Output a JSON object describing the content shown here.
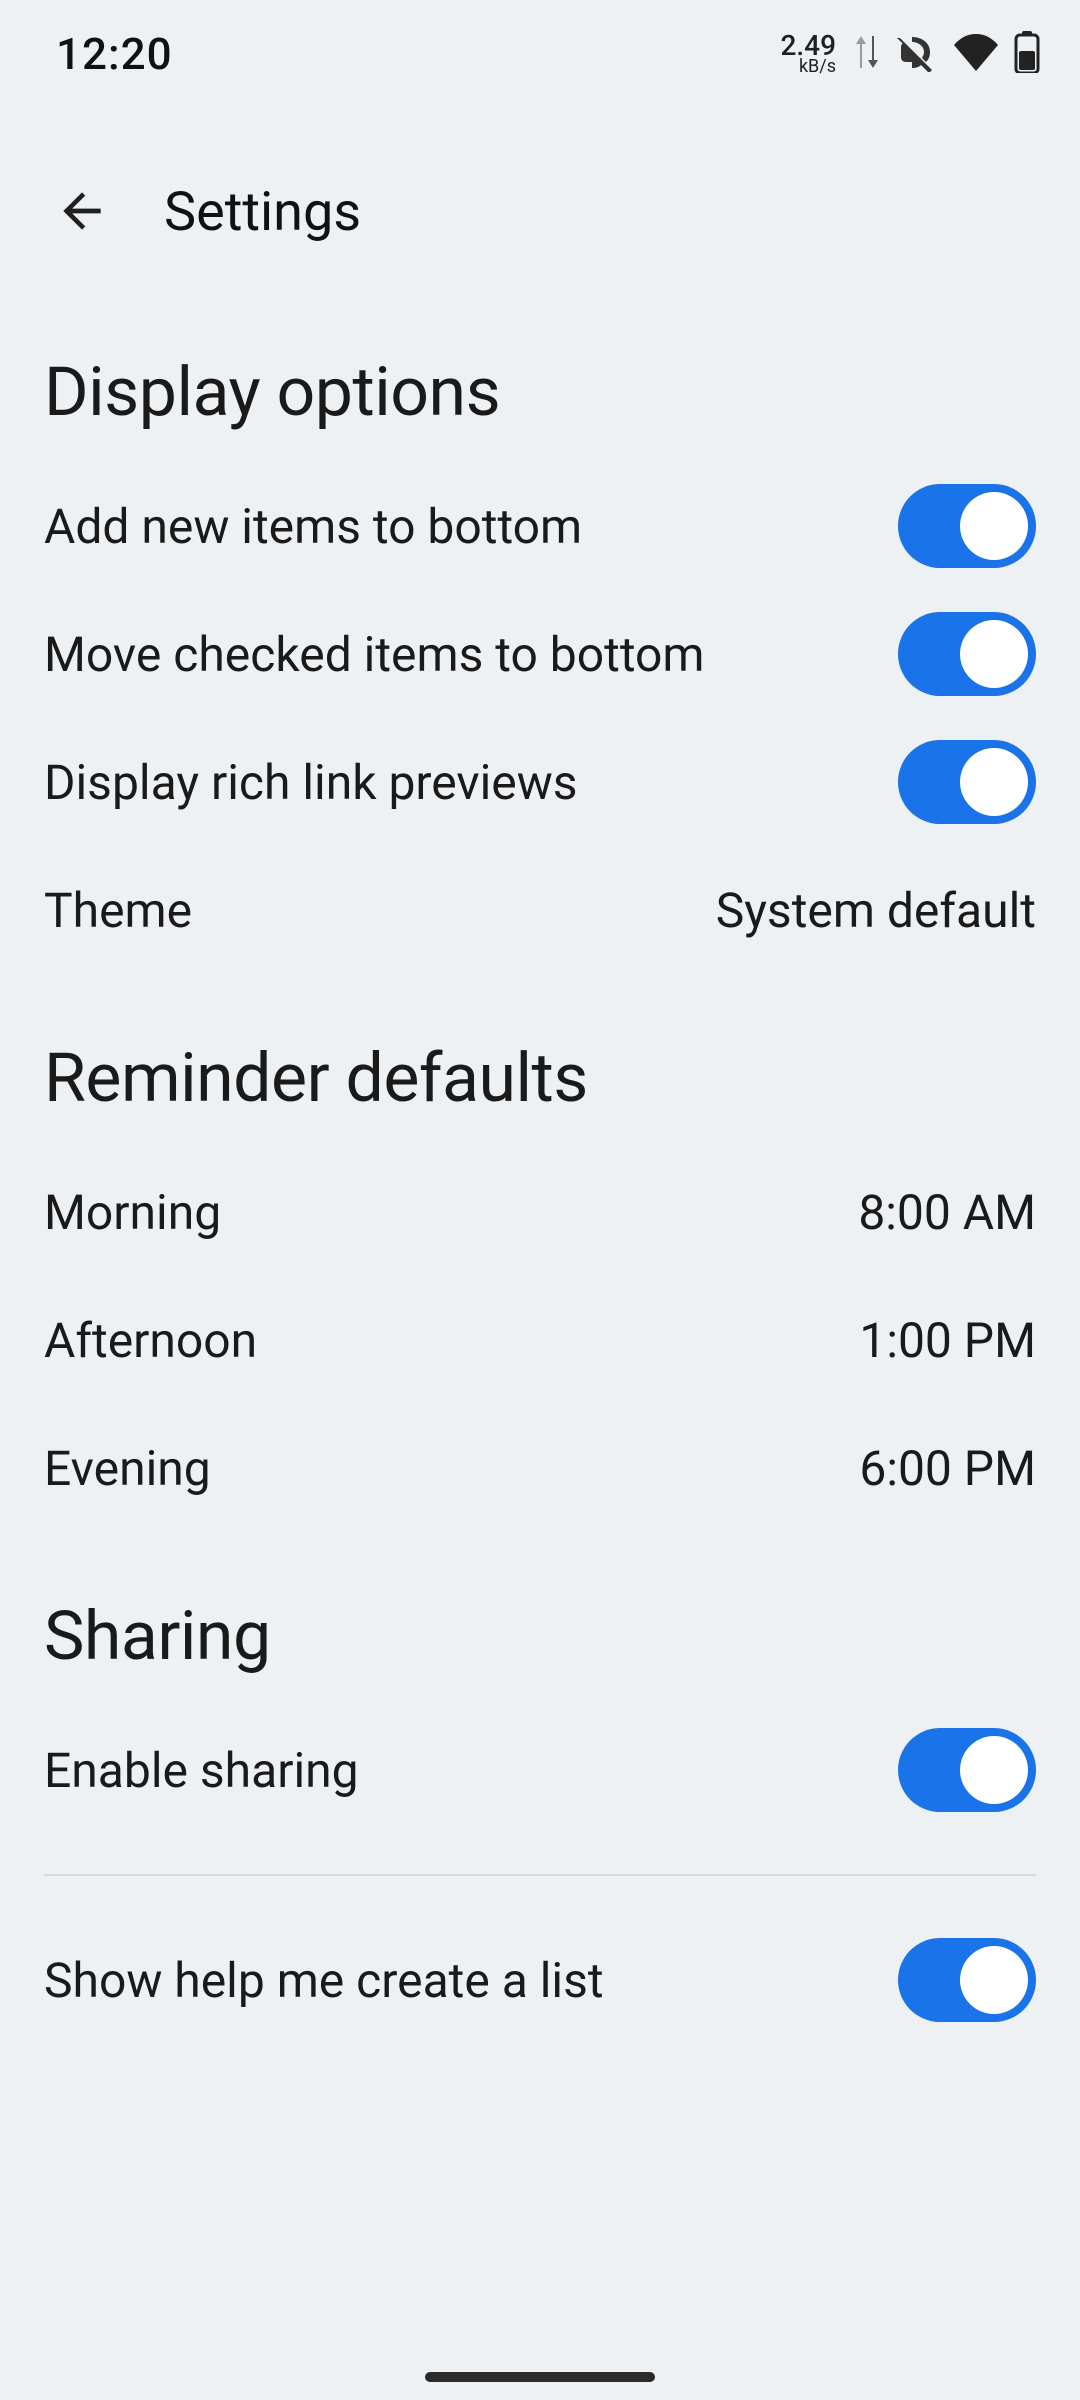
{
  "status": {
    "time": "12:20",
    "net_speed": "2.49",
    "net_unit": "kB/s"
  },
  "header": {
    "title": "Settings"
  },
  "sections": {
    "display": {
      "title": "Display options",
      "add_new": "Add new items to bottom",
      "move_checked": "Move checked items to bottom",
      "rich_link": "Display rich link previews",
      "theme_label": "Theme",
      "theme_value": "System default"
    },
    "reminder": {
      "title": "Reminder defaults",
      "morning_label": "Morning",
      "morning_value": "8:00 AM",
      "afternoon_label": "Afternoon",
      "afternoon_value": "1:00 PM",
      "evening_label": "Evening",
      "evening_value": "6:00 PM"
    },
    "sharing": {
      "title": "Sharing",
      "enable_label": "Enable sharing"
    },
    "misc": {
      "help_list": "Show help me create a list"
    }
  }
}
